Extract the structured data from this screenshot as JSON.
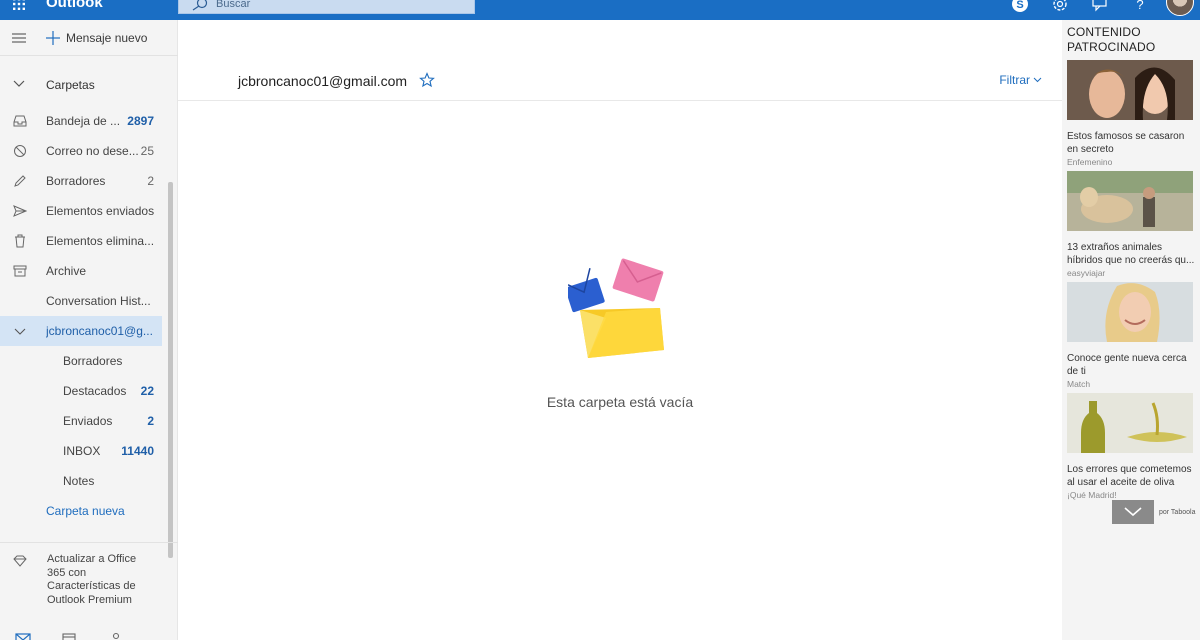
{
  "topbar": {
    "app_name": "Outlook",
    "search_placeholder": "Buscar",
    "icons": [
      "waffle-icon",
      "skype-icon",
      "settings-icon",
      "feedback-icon",
      "help-icon",
      "avatar"
    ],
    "color": "#1a6ec4"
  },
  "leftnav": {
    "new_message_label": "Mensaje nuevo",
    "folders_header": "Carpetas",
    "folders": [
      {
        "name": "Bandeja de ...",
        "count": "2897",
        "bold": true,
        "icon": "inbox-icon"
      },
      {
        "name": "Correo no dese...",
        "count": "25",
        "bold": false,
        "icon": "junk-icon"
      },
      {
        "name": "Borradores",
        "count": "2",
        "bold": false,
        "icon": "pencil-icon"
      },
      {
        "name": "Elementos enviados",
        "count": "",
        "bold": false,
        "icon": "send-icon"
      },
      {
        "name": "Elementos elimina...",
        "count": "",
        "bold": false,
        "icon": "trash-icon"
      },
      {
        "name": "Archive",
        "count": "",
        "bold": false,
        "icon": "archive-icon"
      },
      {
        "name": "Conversation Hist...",
        "count": "",
        "bold": false,
        "icon": ""
      }
    ],
    "account": {
      "name": "jcbroncanoc01@g...",
      "selected": true
    },
    "account_folders": [
      {
        "name": "Borradores",
        "count": ""
      },
      {
        "name": "Destacados",
        "count": "22"
      },
      {
        "name": "Enviados",
        "count": "2"
      },
      {
        "name": "INBOX",
        "count": "11440"
      },
      {
        "name": "Notes",
        "count": ""
      }
    ],
    "new_folder_label": "Carpeta nueva",
    "upgrade_text": "Actualizar a Office 365 con Características de Outlook Premium"
  },
  "main": {
    "account_email": "jcbroncanoc01@gmail.com",
    "filter_label": "Filtrar",
    "empty_message": "Esta carpeta está vacía"
  },
  "ads": {
    "title": "CONTENIDO PATROCINADO",
    "items": [
      {
        "caption": "Estos famosos se casaron en secreto",
        "source": "Enfemenino"
      },
      {
        "caption": "13 extraños animales híbridos que no creerás qu...",
        "source": "easyviajar"
      },
      {
        "caption": "Conoce gente nueva cerca de ti",
        "source": "Match"
      },
      {
        "caption": "Los errores que cometemos al usar el aceite de oliva",
        "source": "¡Qué Madrid!"
      }
    ],
    "powered_by": "por Taboola"
  }
}
